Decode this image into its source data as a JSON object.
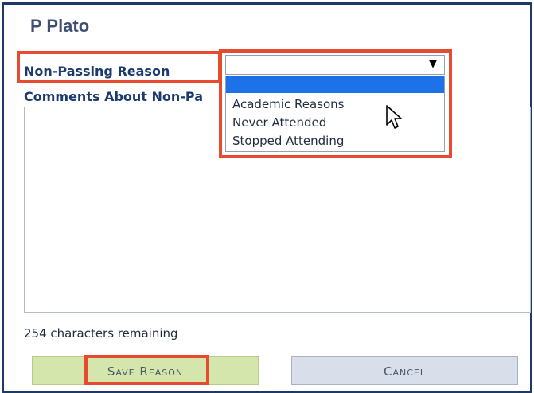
{
  "dialog": {
    "title": "P Plato"
  },
  "form": {
    "reason_label": "Non-Passing Reason",
    "comments_label": "Comments About Non-Pa",
    "reason_select": {
      "selected": "",
      "options": [
        "",
        "Academic Reasons",
        "Never Attended",
        "Stopped Attending"
      ]
    },
    "chars_remaining": "254 characters remaining"
  },
  "buttons": {
    "save_label": "Save Reason",
    "cancel_label": "Cancel"
  },
  "colors": {
    "highlight": "#e84a2f",
    "label_text": "#1b3a6d",
    "selected_option": "#1e72e8",
    "save_button": "#d5e6ad",
    "cancel_button": "#d8deea"
  }
}
